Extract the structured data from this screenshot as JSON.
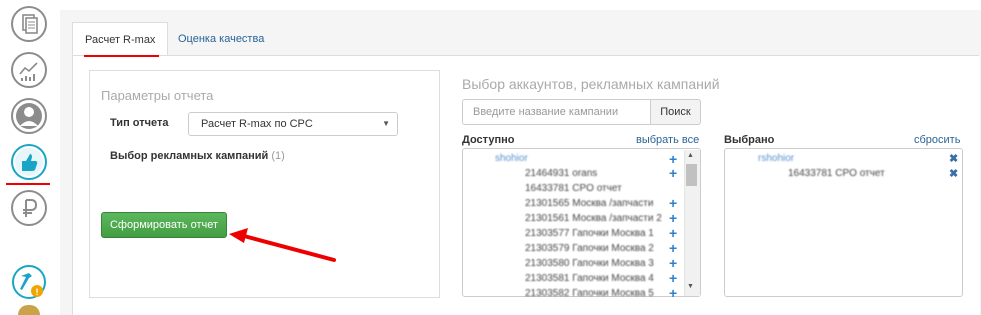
{
  "tabs": [
    {
      "label": "Расчет R-max",
      "active": true
    },
    {
      "label": "Оценка качества",
      "active": false
    }
  ],
  "params": {
    "title": "Параметры отчета",
    "report_type_label": "Тип отчета",
    "report_type_value": "Расчет R-max по CPC",
    "campaigns_label": "Выбор рекламных кампаний",
    "campaigns_count": "(1)",
    "generate_button": "Сформировать отчет"
  },
  "selector": {
    "title": "Выбор аккаунтов, рекламных кампаний",
    "search_placeholder": "Введите название кампании",
    "search_button": "Поиск",
    "available_label": "Доступно",
    "select_all": "выбрать все",
    "selected_label": "Выбрано",
    "reset": "сбросить",
    "available_rows": [
      "shohior",
      "21464931 orans",
      "16433781 CPO отчет",
      "21301565 Москва /запчасти",
      "21301561 Москва /запчасти 2",
      "21303577 Гапочки Москва 1",
      "21303579 Гапочки Москва 2",
      "21303580 Гапочки Москва 3",
      "21303581 Гапочки Москва 4",
      "21303582 Гапочки Москва 5"
    ],
    "selected_rows": [
      "rshohior",
      "16433781 CPO отчет"
    ]
  },
  "icons": [
    "documents-icon",
    "growth-chart-icon",
    "user-icon",
    "thumbs-up-icon",
    "ruble-icon",
    "tools-warning-icon"
  ],
  "colors": {
    "accent_red": "#e00000",
    "green_button": "#4cae4c",
    "link_blue": "#2a6496",
    "active_icon": "#1aa5c6"
  }
}
